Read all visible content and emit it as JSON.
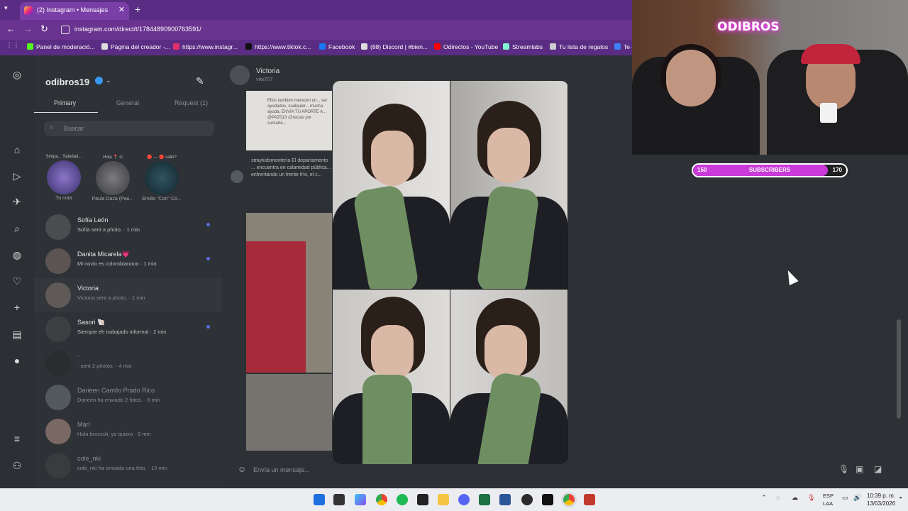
{
  "browser": {
    "tab_title": "(2) Instagram • Mensajes",
    "tab_close": "✕",
    "new_tab": "+",
    "url": "instagram.com/direct/t/17844890900763591/",
    "bookmarks": [
      "Panel de moderació...",
      "Página del creador -...",
      "https://www.instagr...",
      "https://www.tiktok.c...",
      "Facebook",
      "(88) Discord | #bien...",
      "Odirectos - YouTube",
      "Streamlabs",
      "Tu lista de regalos",
      "Te c"
    ]
  },
  "instagram": {
    "username": "odibros19",
    "tabs": {
      "primary": "Primary",
      "general": "General",
      "requests": "Request (1)"
    },
    "search_placeholder": "Buscar",
    "notes": [
      {
        "bubble": "Simpa... Saludad...",
        "name": "Tu nota"
      },
      {
        "bubble": "Hola 📍 ci",
        "name": "Paula Daza (Pau..."
      },
      {
        "bubble": "🔴 — 🔴 salió?",
        "name": "Emilio \"Cori\" Co..."
      }
    ],
    "conversations": [
      {
        "name": "Sofía León",
        "message": "Sofía sent a photo. · 1 min",
        "unread": true
      },
      {
        "name": "Danita Micarela💗",
        "message": "Mi novio es colombianooo · 1 min",
        "unread": true
      },
      {
        "name": "Victoria",
        "message": "Victoria sent a photo. · 1 min",
        "unread": false,
        "active": true
      },
      {
        "name": "Sasori 🐚",
        "message": "Siempre eh trabajado informal · 2 min",
        "unread": true
      },
      {
        "name": "·",
        "message": "· sent 2 photos. · 4 min",
        "unread": false
      },
      {
        "name": "Darieen Camilo Prado Rico",
        "message": "Darieen ha enviado 2 fotos. · 6 min",
        "unread": false
      },
      {
        "name": "Marí",
        "message": "Hola broccoli, yo quiero · 8 min",
        "unread": false
      },
      {
        "name": "cole_nki",
        "message": "cole_nki ha enviado una foto. · 10 min",
        "unread": false
      }
    ],
    "chat": {
      "name": "Victoria",
      "user": "vikii707",
      "post_text": "Ellos también merecen un... ser ayudados, cualquier... mucha ayuda. ENVÍA TU APORTE A... @PAZ013 ¡Gracias por sumarte...",
      "caption": "straykidsmontería El departamento ... encuentra en calamidad pública... enfrentando un frente frío, el c...",
      "input_placeholder": "Envía un mensaje..."
    }
  },
  "stream": {
    "neon_sign": "ODIBROS",
    "subs_low": "150",
    "subs_label": "SUBSCRIBERS",
    "subs_high": "170",
    "subs_progress": 0.88
  },
  "taskbar": {
    "lang_top": "ESP",
    "lang_bottom": "LAA",
    "time": "10:39 p. m.",
    "date": "13/03/2026"
  },
  "colors": {
    "chrome": "#5b2c83",
    "unread_dot": "#5b6be0",
    "subs_fill": "#c93ad8"
  }
}
